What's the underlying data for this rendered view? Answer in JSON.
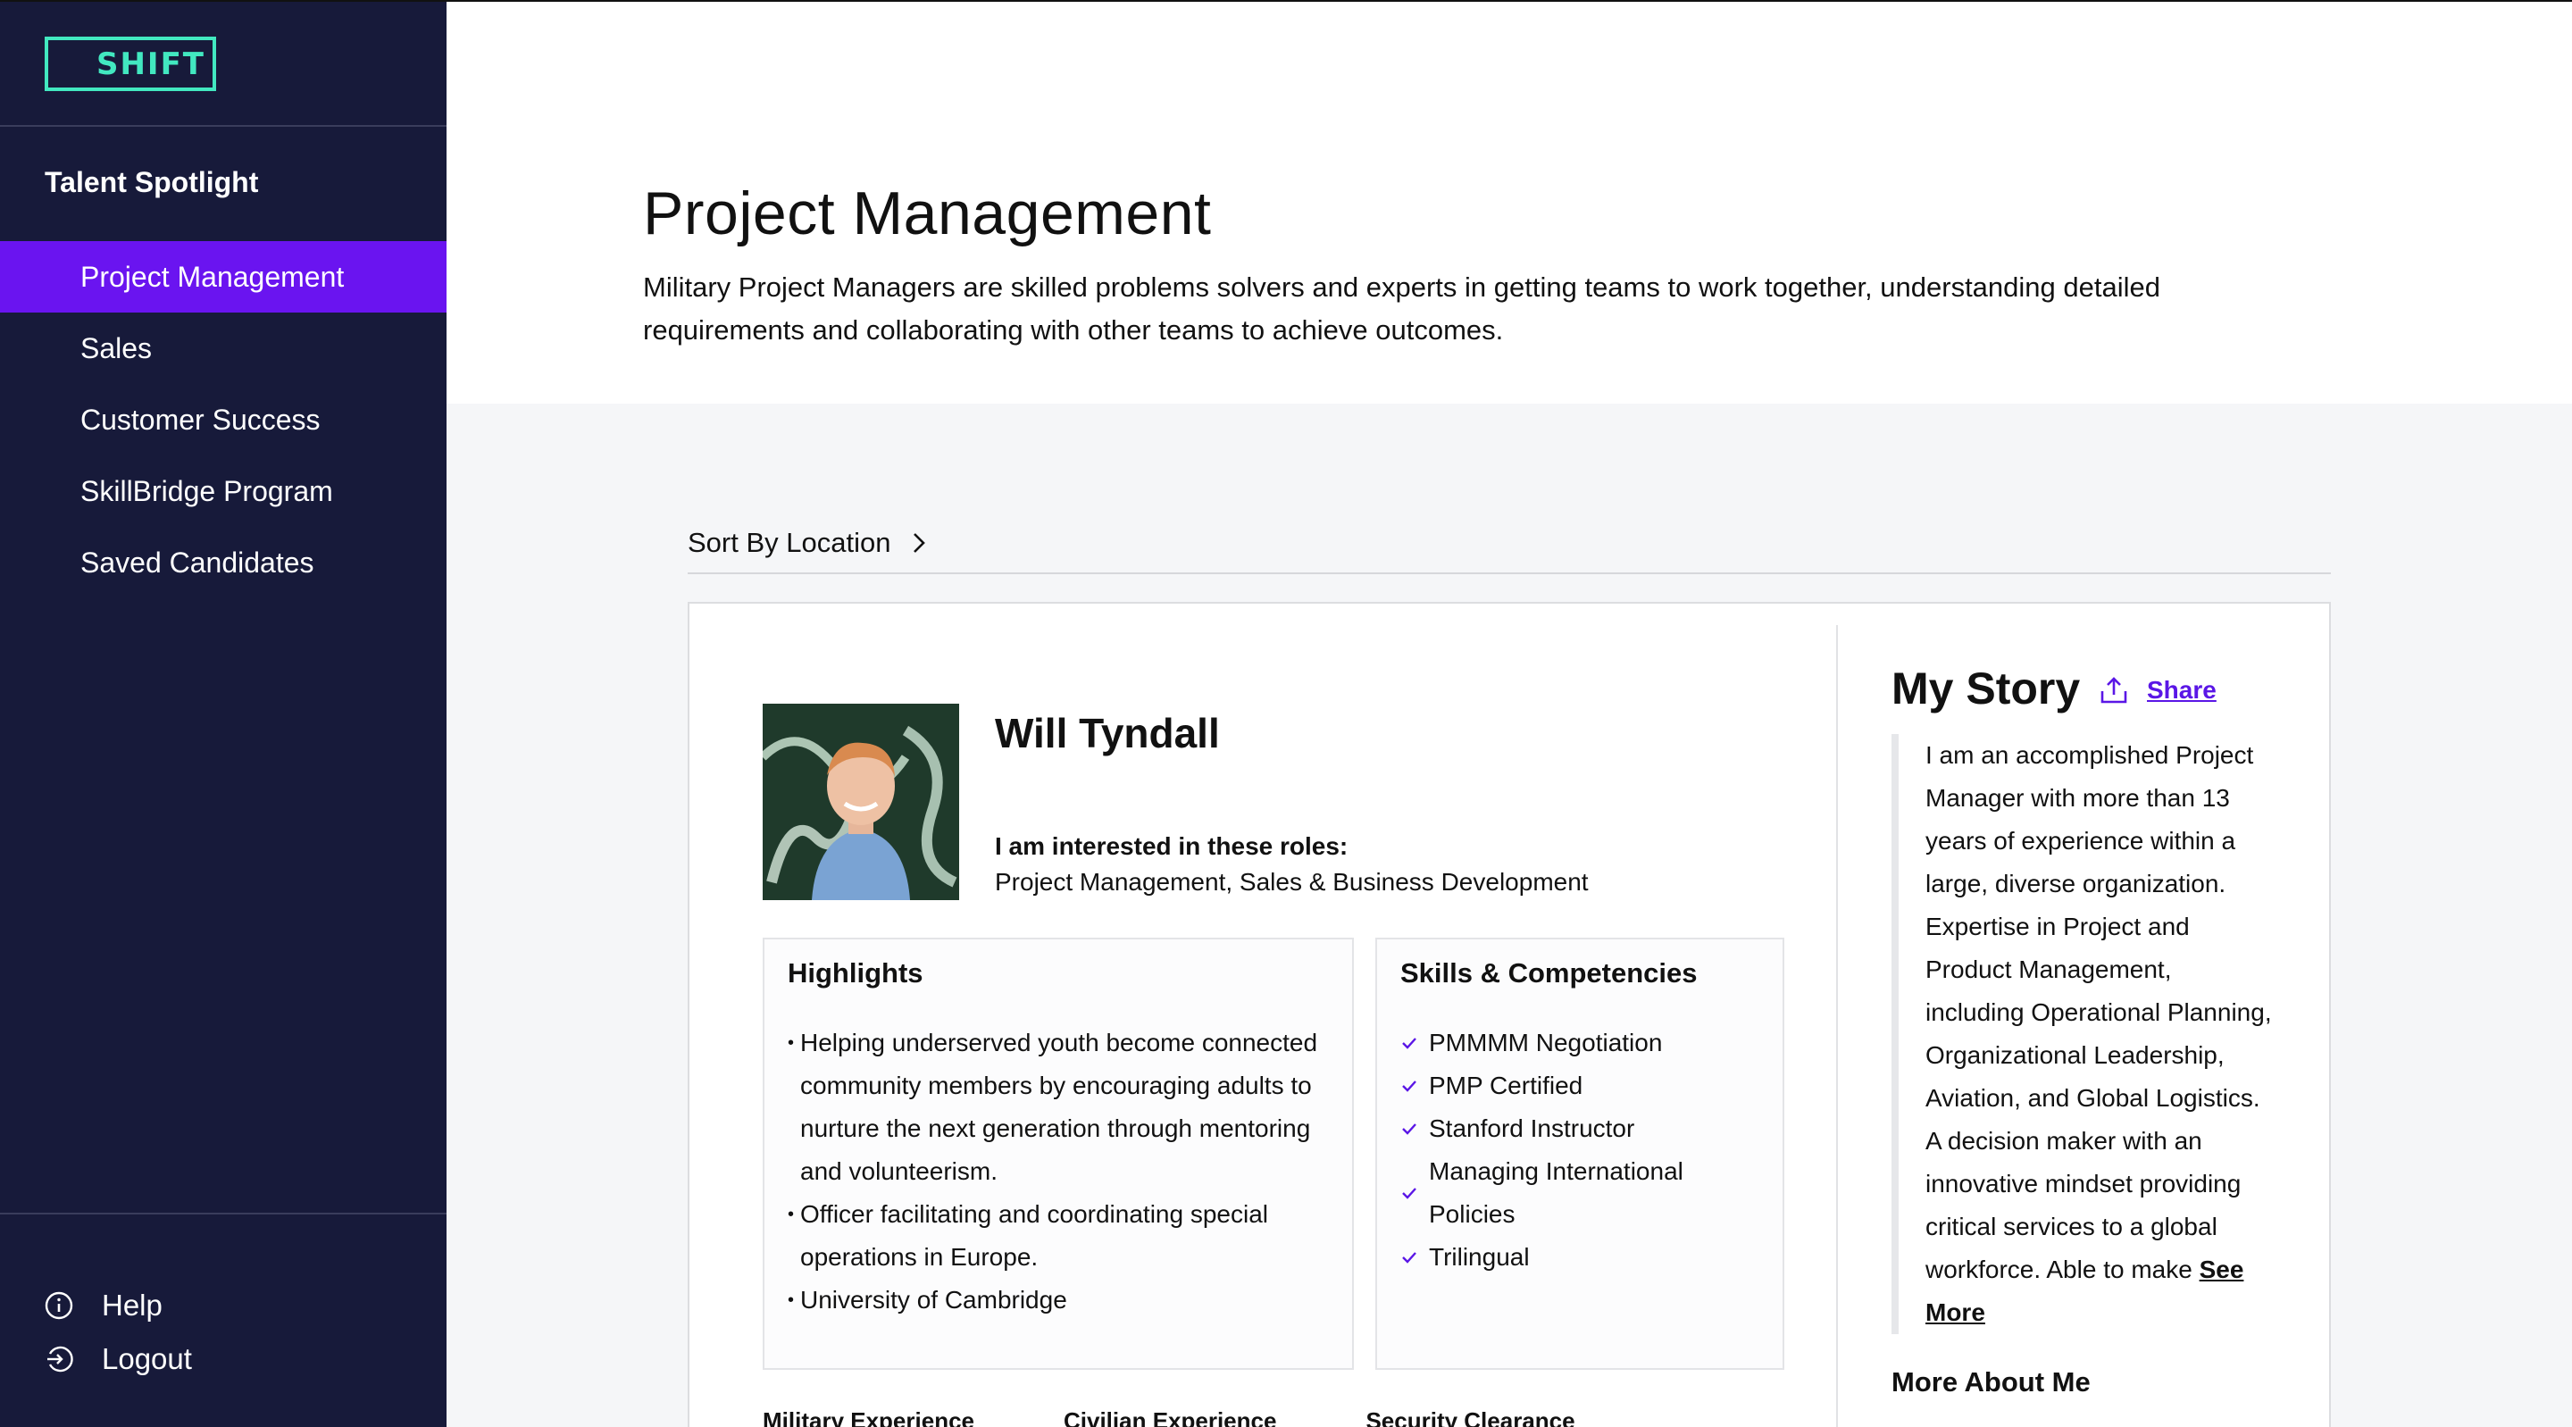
{
  "brand": {
    "logo_text": "SHIFT",
    "accent": "#42e8c0",
    "sidebar_bg": "#171a3a",
    "active_bg": "#6a14f0"
  },
  "sidebar": {
    "section_title": "Talent Spotlight",
    "items": [
      {
        "label": "Project Management",
        "active": true
      },
      {
        "label": "Sales",
        "active": false
      },
      {
        "label": "Customer Success",
        "active": false
      },
      {
        "label": "SkillBridge Program",
        "active": false
      },
      {
        "label": "Saved Candidates",
        "active": false
      }
    ],
    "help_label": "Help",
    "logout_label": "Logout"
  },
  "page": {
    "title": "Project Management",
    "description": "Military Project Managers are skilled problems solvers and experts in getting teams to work together, understanding detailed requirements and collaborating with other teams to achieve outcomes."
  },
  "sort": {
    "label": "Sort By Location"
  },
  "candidate": {
    "name": "Will Tyndall",
    "roles_label": "I am interested in these roles:",
    "roles_value": "Project Management, Sales & Business Development",
    "highlights_title": "Highlights",
    "highlights": [
      "Helping underserved youth become connected community members by encouraging adults to nurture the next generation through mentoring and volunteerism.",
      "Officer facilitating and coordinating special operations in Europe.",
      "University of Cambridge"
    ],
    "skills_title": "Skills & Competencies",
    "skills": [
      "PMMMM Negotiation",
      "PMP Certified",
      "Stanford Instructor",
      "Managing International Policies",
      "Trilingual"
    ],
    "bottom_labels": [
      "Military Experience",
      "Civilian Experience",
      "Security Clearance"
    ],
    "story_title": "My Story",
    "share_label": "Share",
    "story_text": "I am an accomplished Project Manager with more than 13 years of experience within a large, diverse organization. Expertise in Project and Product Management, including Operational Planning, Organizational Leadership, Aviation, and Global Logistics. A decision maker with an innovative mindset providing critical services to a global workforce. Able to make",
    "see_more_label": "See More",
    "more_about_label": "More About Me"
  }
}
